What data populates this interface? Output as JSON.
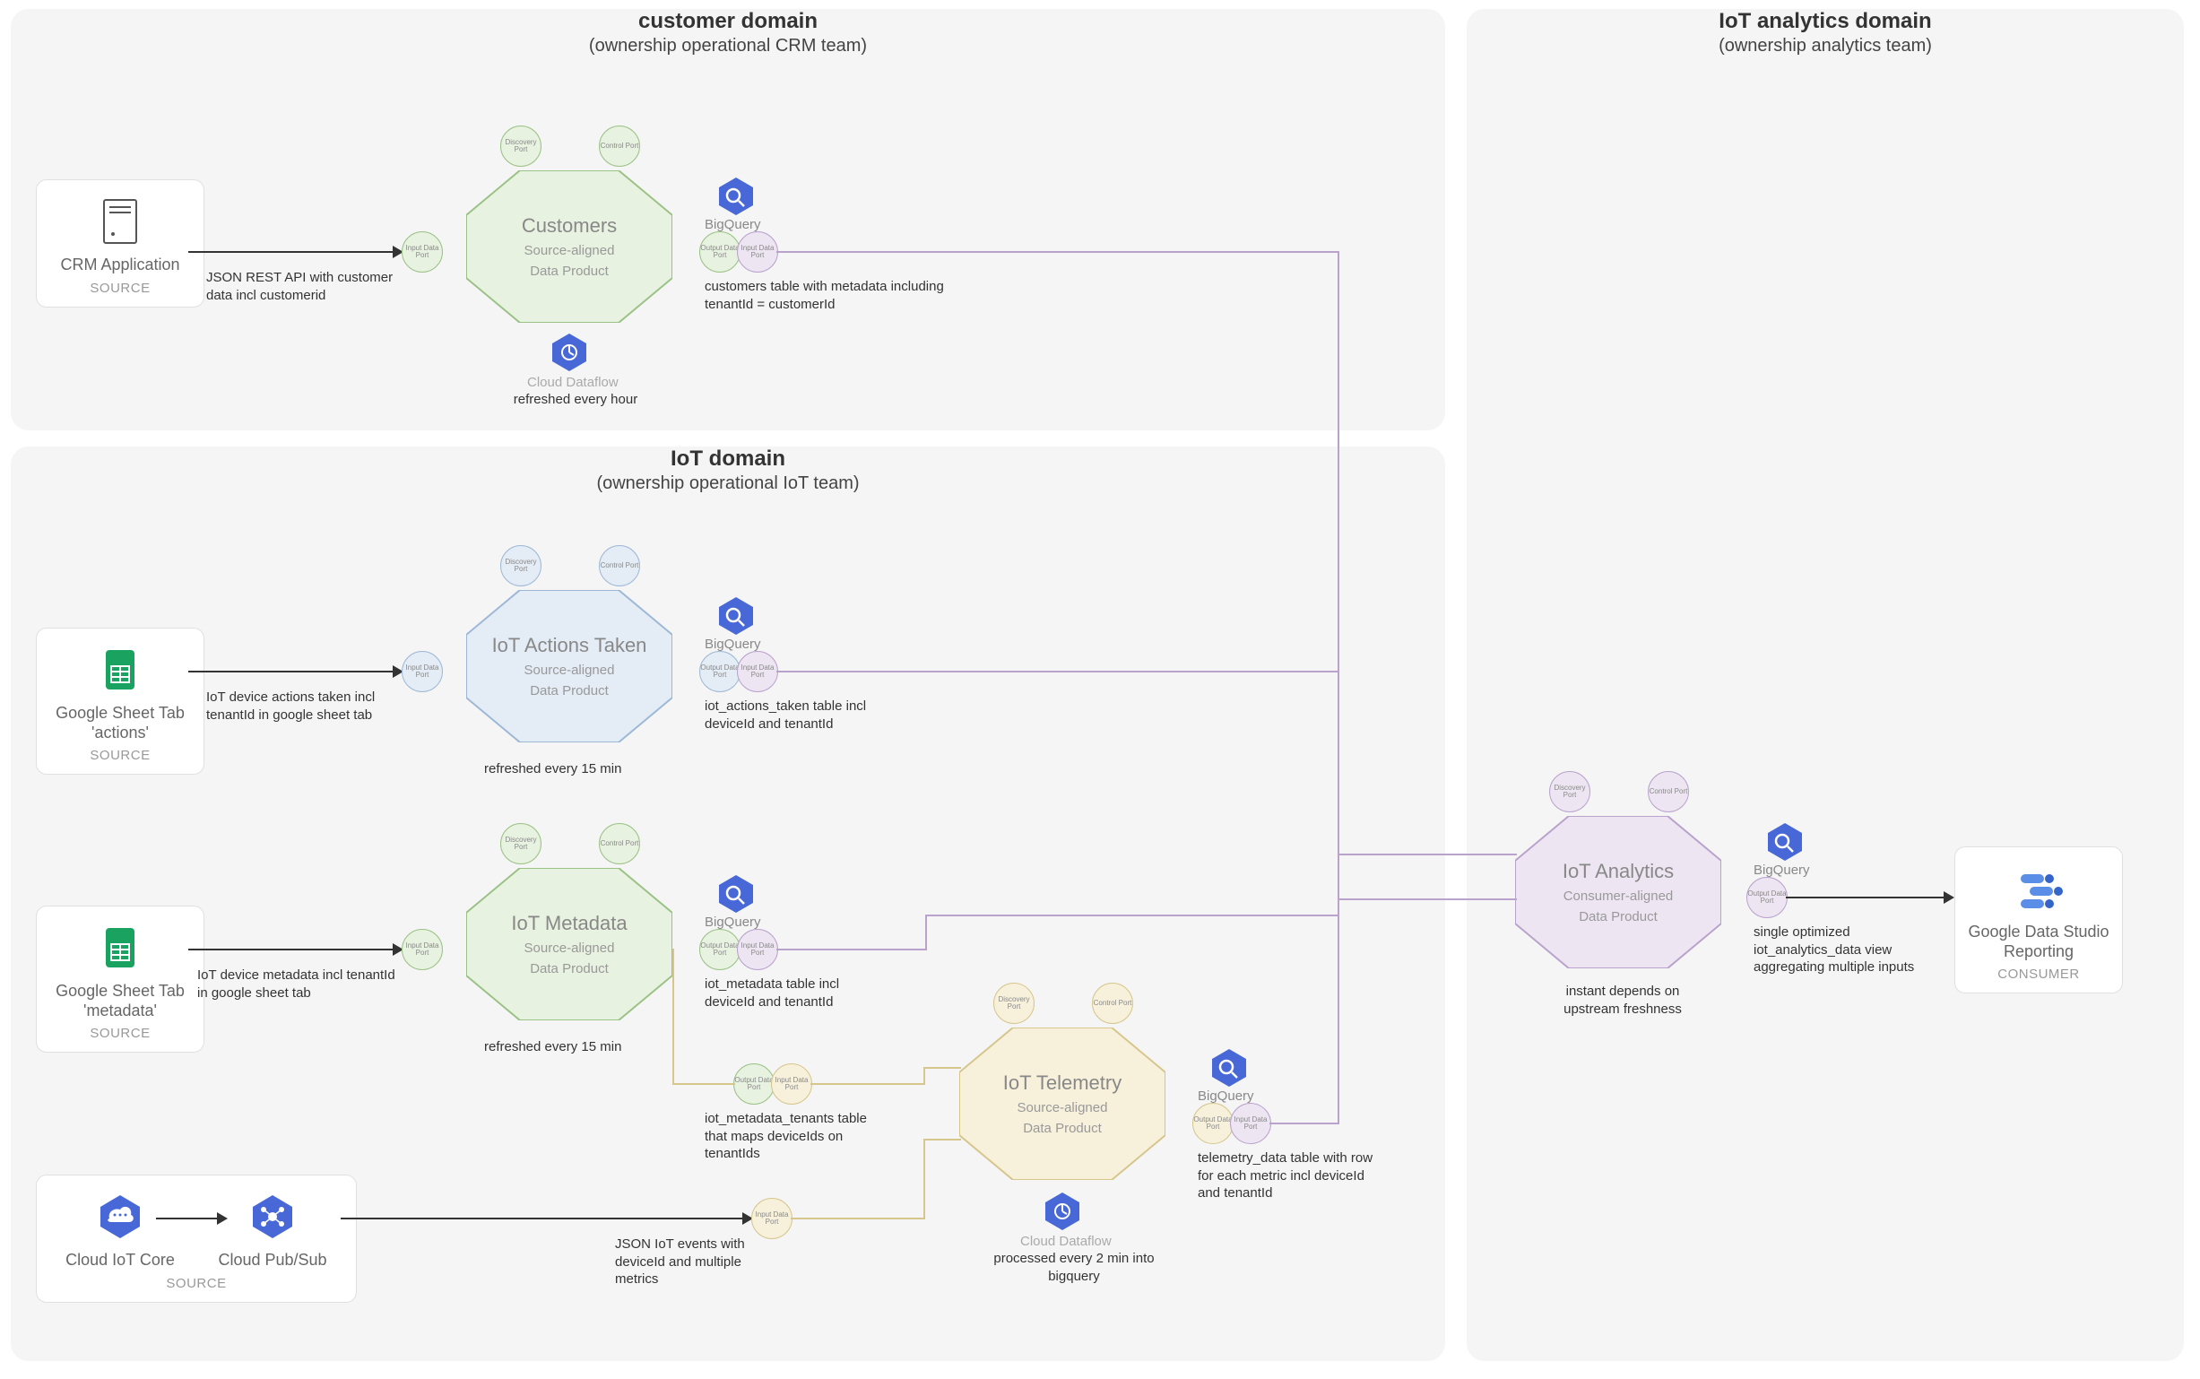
{
  "domains": {
    "customer": {
      "title": "customer domain",
      "sub": "(ownership operational CRM team)"
    },
    "iot": {
      "title": "IoT domain",
      "sub": "(ownership operational IoT team)"
    },
    "analytics": {
      "title": "IoT analytics domain",
      "sub": "(ownership analytics team)"
    }
  },
  "sources": {
    "crm": {
      "label": "CRM Application",
      "tag": "SOURCE"
    },
    "sheet_actions": {
      "label": "Google Sheet Tab 'actions'",
      "tag": "SOURCE"
    },
    "sheet_metadata": {
      "label": "Google Sheet Tab 'metadata'",
      "tag": "SOURCE"
    },
    "iot_core": {
      "label": "Cloud IoT Core"
    },
    "pubsub": {
      "label": "Cloud Pub/Sub"
    },
    "source_tag": "SOURCE"
  },
  "consumer": {
    "label": "Google Data Studio Reporting",
    "tag": "CONSUMER"
  },
  "products": {
    "customers": {
      "title": "Customers",
      "sub1": "Source-aligned",
      "sub2": "Data Product"
    },
    "actions": {
      "title": "IoT Actions Taken",
      "sub1": "Source-aligned",
      "sub2": "Data Product"
    },
    "metadata": {
      "title": "IoT Metadata",
      "sub1": "Source-aligned",
      "sub2": "Data Product"
    },
    "telemetry": {
      "title": "IoT Telemetry",
      "sub1": "Source-aligned",
      "sub2": "Data Product"
    },
    "analytics": {
      "title": "IoT Analytics",
      "sub1": "Consumer-aligned",
      "sub2": "Data Product"
    }
  },
  "ports": {
    "discovery": "Discovery Port",
    "control": "Control Port",
    "input": "Input Data Port",
    "output": "Output Data Port"
  },
  "icons": {
    "bigquery": "BigQuery",
    "dataflow": "Cloud Dataflow"
  },
  "annots": {
    "crm_api": "JSON REST API with customer data incl customerid",
    "customers_table": "customers table with metadata including tenantId = customerId",
    "customers_refresh": "refreshed every hour",
    "actions_input": "IoT device actions taken incl tenantId in google sheet tab",
    "actions_table": "iot_actions_taken table incl deviceId and tenantId",
    "actions_refresh": "refreshed every 15 min",
    "metadata_input": "IoT device metadata incl tenantId in google sheet tab",
    "metadata_table": "iot_metadata table incl deviceId and tenantId",
    "metadata_refresh": "refreshed every 15 min",
    "metadata_tenants": "iot_metadata_tenants table that maps deviceIds on tenantIds",
    "telemetry_input": "JSON IoT events with deviceId and multiple metrics",
    "telemetry_table": "telemetry_data table with row for each metric incl deviceId and tenantId",
    "telemetry_proc": "processed every 2 min into bigquery",
    "analytics_out": "single optimized iot_analytics_data view aggregating multiple inputs",
    "analytics_fresh": "instant depends on upstream freshness"
  }
}
